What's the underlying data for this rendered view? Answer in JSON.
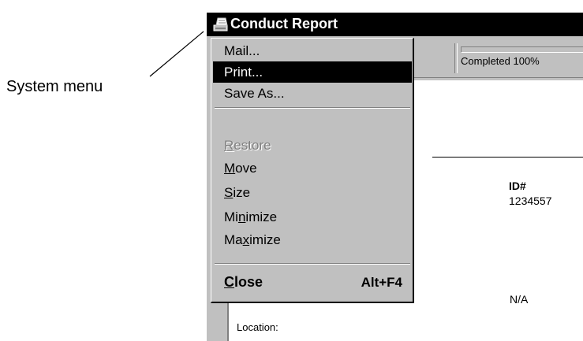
{
  "annotation": {
    "label": "System menu"
  },
  "window": {
    "title": "Conduct Report",
    "icon": "printer-icon"
  },
  "toolbar": {
    "progress_text": "Completed 100%",
    "progress_value": 1.0
  },
  "report": {
    "id_label": "ID#",
    "id_value": "1234557",
    "na_value": "N/A",
    "location_label": "Location:"
  },
  "system_menu": {
    "items": [
      {
        "label": "Mail...",
        "state": "normal"
      },
      {
        "label": "Print...",
        "state": "selected"
      },
      {
        "label": "Save As...",
        "state": "normal"
      },
      {
        "label": "Restore",
        "state": "disabled",
        "mnemonic": "R"
      },
      {
        "label": "Move",
        "state": "normal",
        "mnemonic": "M"
      },
      {
        "label": "Size",
        "state": "normal",
        "mnemonic": "S"
      },
      {
        "label": "Minimize",
        "state": "normal",
        "mnemonic": "n"
      },
      {
        "label": "Maximize",
        "state": "normal",
        "mnemonic": "x"
      },
      {
        "label": "Close",
        "shortcut": "Alt+F4",
        "state": "normal",
        "mnemonic": "C"
      }
    ]
  },
  "colors": {
    "titlebar": "#000000",
    "menu_bg": "#c0c0c0",
    "selection": "#000000",
    "disabled_text": "#808080"
  }
}
